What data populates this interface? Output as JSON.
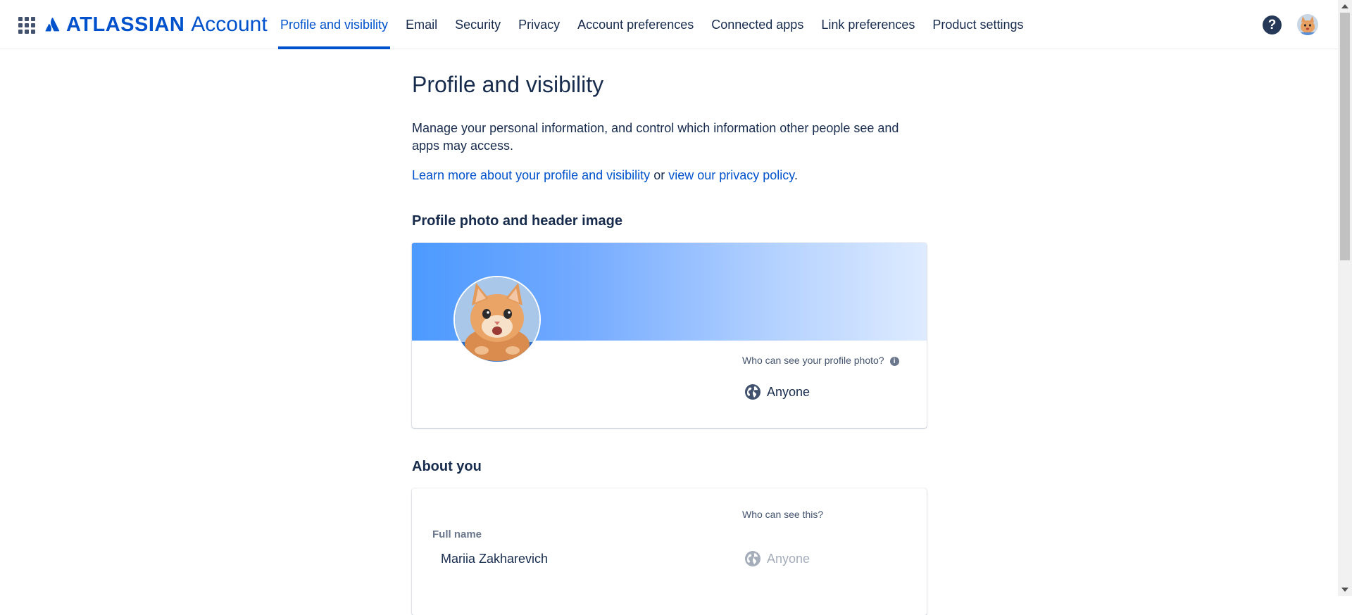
{
  "header": {
    "brand_name": "ATLASSIAN",
    "brand_product": "Account",
    "app_switcher_icon": "app-switcher-icon",
    "help_icon": "question-icon",
    "help_glyph": "?",
    "accent_color": "#0052CC",
    "tabs": [
      {
        "label": "Profile and visibility",
        "active": true
      },
      {
        "label": "Email",
        "active": false
      },
      {
        "label": "Security",
        "active": false
      },
      {
        "label": "Privacy",
        "active": false
      },
      {
        "label": "Account preferences",
        "active": false
      },
      {
        "label": "Connected apps",
        "active": false
      },
      {
        "label": "Link preferences",
        "active": false
      },
      {
        "label": "Product settings",
        "active": false
      }
    ]
  },
  "main": {
    "title": "Profile and visibility",
    "intro": "Manage your personal information, and control which information other people see and apps may access.",
    "learn_more_link": "Learn more about your profile and visibility",
    "links_joiner": " or ",
    "privacy_link": "view our privacy policy",
    "links_end": ".",
    "photo_section": {
      "title": "Profile photo and header image",
      "visibility_question": "Who can see your profile photo?",
      "info_glyph": "i",
      "visibility_value": "Anyone",
      "visibility_icon": "globe-icon"
    },
    "about_section": {
      "title": "About you",
      "visibility_question": "Who can see this?",
      "fields": [
        {
          "label": "Full name",
          "value": "Mariia Zakharevich",
          "visibility": "Anyone",
          "visibility_icon": "globe-icon"
        }
      ]
    }
  }
}
